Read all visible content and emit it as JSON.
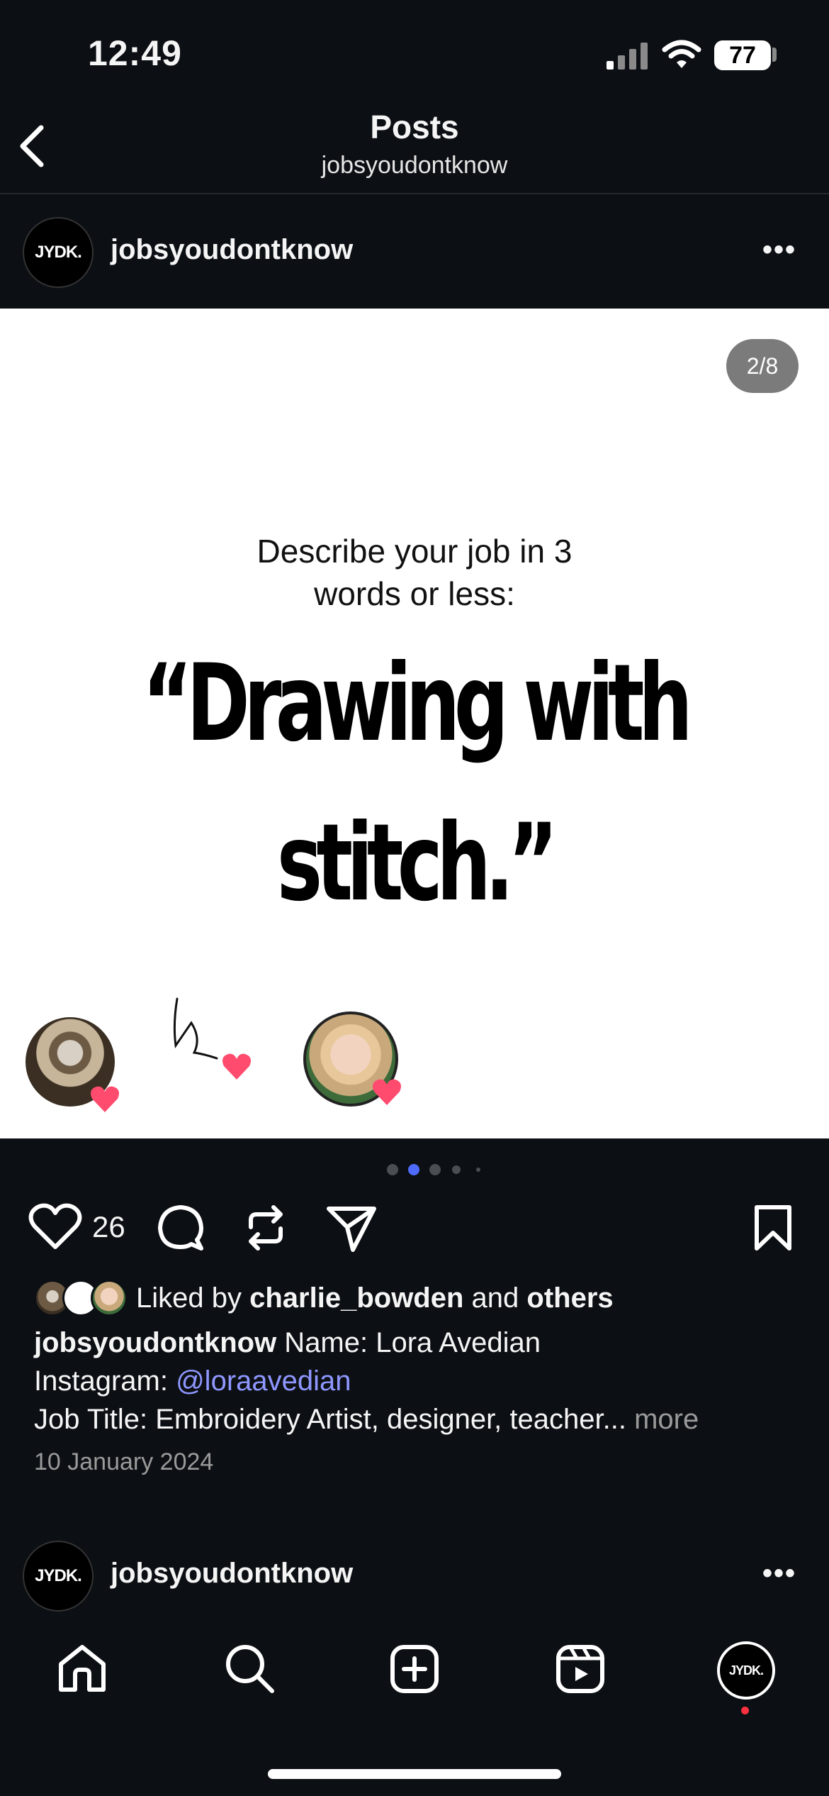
{
  "status_bar": {
    "time": "12:49",
    "battery": "77"
  },
  "header": {
    "title": "Posts",
    "subtitle": "jobsyoudontknow"
  },
  "post": {
    "avatar_text": "JYDK.",
    "username": "jobsyoudontknow",
    "more": "•••",
    "slide_counter": "2/8",
    "prompt_line1": "Describe your job in 3",
    "prompt_line2": "words or less:",
    "quote_line1": "“Drawing with",
    "quote_line2": "stitch.”",
    "carousel": {
      "total_dots": 5,
      "active_index": 1
    },
    "like_count": "26",
    "liked_by_prefix": "Liked by ",
    "liked_by_user": "charlie_bowden",
    "liked_by_and": " and ",
    "liked_by_others": "others",
    "caption_user": "jobsyoudontknow",
    "caption_line1": " Name: Lora Avedian",
    "caption_line2_label": "Instagram: ",
    "caption_line2_link": "@loraavedian",
    "caption_line3": "Job Title: Embroidery Artist, designer, teacher...",
    "caption_more": " more",
    "date": "10 January 2024"
  },
  "next_post": {
    "avatar_text": "JYDK.",
    "username": "jobsyoudontknow",
    "more": "•••"
  },
  "bottom_nav": {
    "profile_avatar_text": "JYDK."
  },
  "colors": {
    "background": "#0c1014",
    "link": "#8f97ff",
    "active_dot": "#4f6bff",
    "heart": "#ff3b5c",
    "notification": "#ff3040"
  }
}
